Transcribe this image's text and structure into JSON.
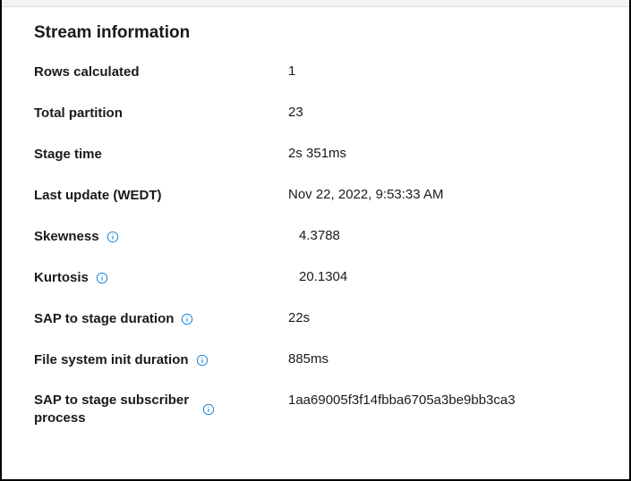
{
  "title": "Stream information",
  "rows": [
    {
      "label": "Rows calculated",
      "value": "1",
      "info": false,
      "indent": false
    },
    {
      "label": "Total partition",
      "value": "23",
      "info": false,
      "indent": false
    },
    {
      "label": "Stage time",
      "value": "2s 351ms",
      "info": false,
      "indent": false
    },
    {
      "label": "Last update (WEDT)",
      "value": "Nov 22, 2022, 9:53:33 AM",
      "info": false,
      "indent": false
    },
    {
      "label": "Skewness",
      "value": "4.3788",
      "info": true,
      "indent": true
    },
    {
      "label": "Kurtosis",
      "value": "20.1304",
      "info": true,
      "indent": true
    },
    {
      "label": "SAP to stage duration",
      "value": "22s",
      "info": true,
      "indent": false
    },
    {
      "label": "File system init duration",
      "value": "885ms",
      "info": true,
      "indent": false,
      "wrap": true
    },
    {
      "label": "SAP to stage subscriber process",
      "value": "1aa69005f3f14fbba6705a3be9bb3ca3",
      "info": true,
      "indent": false,
      "wrap": true
    }
  ]
}
